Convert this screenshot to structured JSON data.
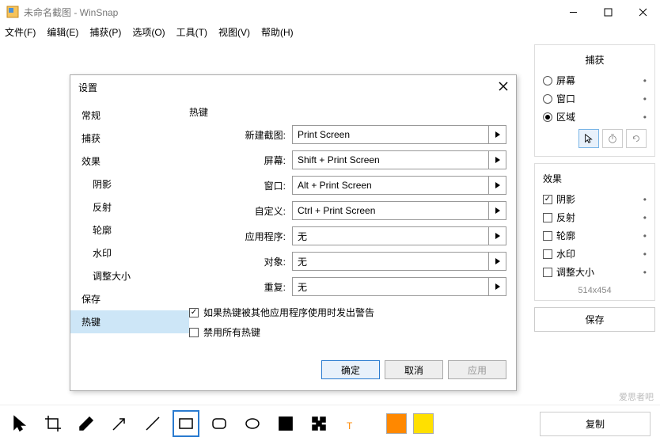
{
  "window": {
    "title": "未命名截图 - WinSnap"
  },
  "menu": {
    "file": "文件(F)",
    "edit": "编辑(E)",
    "capture": "捕获(P)",
    "options": "选项(O)",
    "tools": "工具(T)",
    "view": "视图(V)",
    "help": "帮助(H)"
  },
  "right": {
    "capture_title": "捕获",
    "radios": {
      "screen": "屏幕",
      "window": "窗口",
      "region": "区域"
    },
    "effects_title": "效果",
    "effects": {
      "shadow": "阴影",
      "reflect": "反射",
      "outline": "轮廓",
      "watermark": "水印",
      "resize": "调整大小"
    },
    "dim": "514x454",
    "save": "保存",
    "copy": "复制"
  },
  "dialog": {
    "title": "设置",
    "nav": [
      "常规",
      "捕获",
      "效果",
      "阴影",
      "反射",
      "轮廓",
      "水印",
      "调整大小",
      "保存",
      "热键"
    ],
    "section": "热键",
    "rows": {
      "new": {
        "label": "新建截图:",
        "value": "Print Screen"
      },
      "screen": {
        "label": "屏幕:",
        "value": "Shift + Print Screen"
      },
      "window": {
        "label": "窗口:",
        "value": "Alt + Print Screen"
      },
      "custom": {
        "label": "自定义:",
        "value": "Ctrl + Print Screen"
      },
      "app": {
        "label": "应用程序:",
        "value": "无"
      },
      "object": {
        "label": "对象:",
        "value": "无"
      },
      "repeat": {
        "label": "重复:",
        "value": "无"
      }
    },
    "warn": "如果热键被其他应用程序使用时发出警告",
    "disable": "禁用所有热键",
    "ok": "确定",
    "cancel": "取消",
    "apply": "应用"
  },
  "watermark": "爱思者吧"
}
